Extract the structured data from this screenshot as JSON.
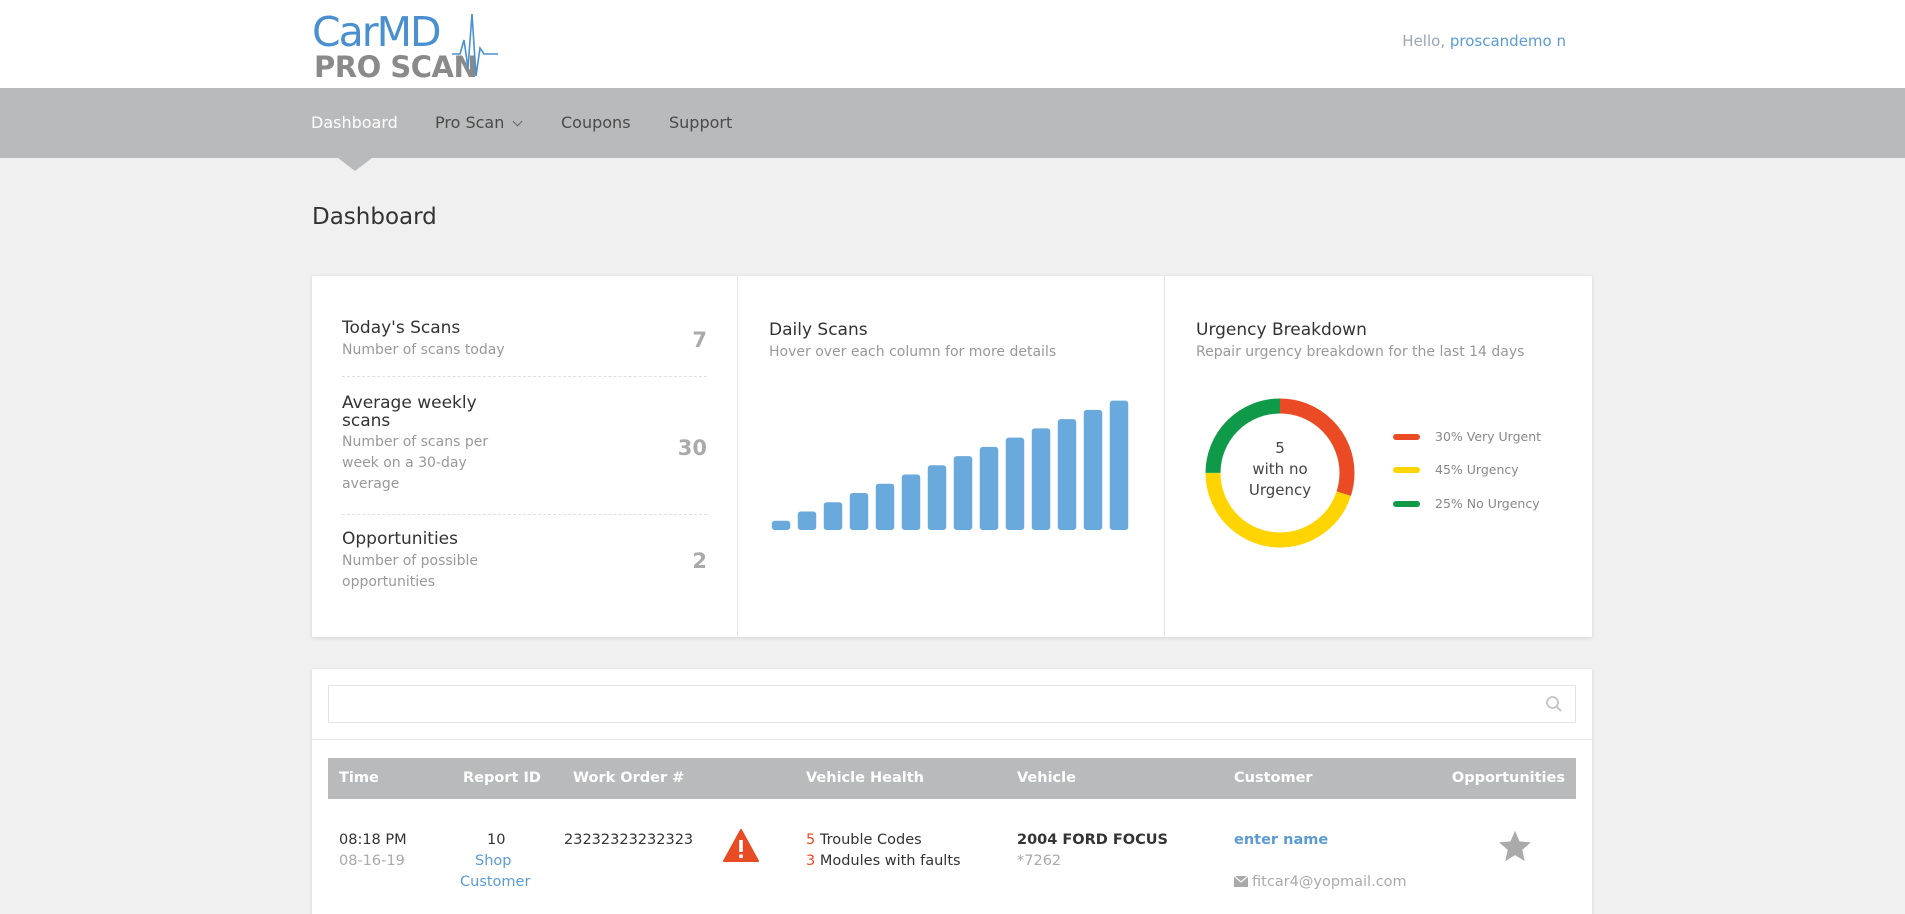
{
  "header": {
    "logo_top": "CarMD",
    "logo_bottom": "PRO SCAN",
    "hello_prefix": "Hello,",
    "username": "proscandemo n"
  },
  "nav": {
    "items": [
      {
        "label": "Dashboard",
        "active": true
      },
      {
        "label": "Pro Scan",
        "has_dropdown": true
      },
      {
        "label": "Coupons"
      },
      {
        "label": "Support"
      }
    ]
  },
  "page": {
    "title": "Dashboard"
  },
  "stats": {
    "todays_scans": {
      "title": "Today's Scans",
      "desc": "Number of scans today",
      "value": "7"
    },
    "avg_weekly": {
      "title_line1": "Average weekly",
      "title_line2": "scans",
      "desc_line1": "Number of scans per",
      "desc_line2": "week on a 30-day",
      "desc_line3": "average",
      "value": "30"
    },
    "opportunities": {
      "title": "Opportunities",
      "desc_line1": "Number of possible",
      "desc_line2": "opportunities",
      "value": "2"
    }
  },
  "daily_scans": {
    "title": "Daily Scans",
    "subtitle": "Hover over each column for more details",
    "bar_color": "#6aa9dc"
  },
  "chart_data": {
    "type": "bar",
    "categories": [
      "",
      "",
      "",
      "",
      "",
      "",
      "",
      "",
      "",
      "",
      "",
      "",
      "",
      ""
    ],
    "values": [
      1,
      2,
      3,
      4,
      5,
      6,
      7,
      8,
      9,
      10,
      11,
      12,
      13,
      14
    ],
    "title": "Daily Scans",
    "xlabel": "",
    "ylabel": "",
    "ylim": [
      0,
      14.5
    ],
    "grid": false
  },
  "urgency": {
    "title": "Urgency Breakdown",
    "subtitle": "Repair urgency breakdown for the last 14 days",
    "center_line1": "5",
    "center_line2": "with no",
    "center_line3": "Urgency",
    "segments": [
      {
        "label": "30% Very Urgent",
        "percent": 30,
        "color": "#ea4b24"
      },
      {
        "label": "45% Urgency",
        "percent": 45,
        "color": "#ffd400"
      },
      {
        "label": "25% No Urgency",
        "percent": 25,
        "color": "#0f9a4a"
      }
    ]
  },
  "table": {
    "search_placeholder": "",
    "columns": [
      "Time",
      "Report ID",
      "Work Order #",
      "Vehicle Health",
      "Vehicle",
      "Customer",
      "Opportunities"
    ],
    "rows": [
      {
        "time": "08:18 PM",
        "date": "08-16-19",
        "report_id": "10",
        "report_link1": "Shop",
        "report_link2": "Customer",
        "work_order": "23232323232323",
        "trouble_count": "5",
        "trouble_label": "Trouble Codes",
        "modules_count": "3",
        "modules_label": "Modules with faults",
        "vehicle": "2004 FORD FOCUS",
        "vin_suffix": "*7262",
        "customer_name": "enter name",
        "customer_email": "fitcar4@yopmail.com"
      }
    ]
  }
}
